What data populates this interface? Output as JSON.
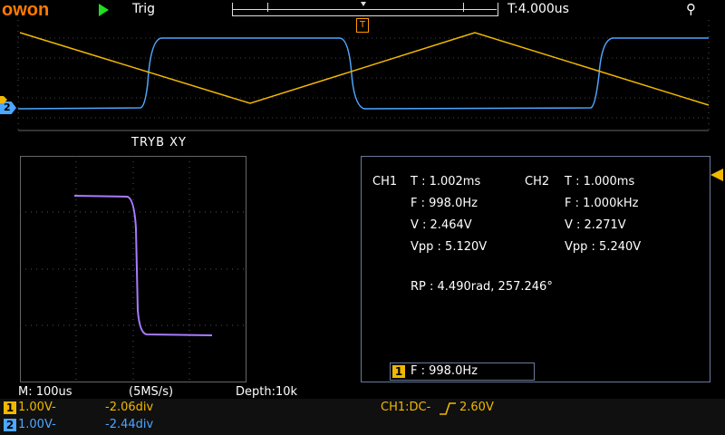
{
  "header": {
    "brand": "owon",
    "trigger_status": "Trig",
    "time_offset": "T:4.000us",
    "trigger_marker": "T"
  },
  "xy_title": "TRYB XY",
  "measurements": {
    "ch1": {
      "label": "CH1",
      "T": "T : 1.002ms",
      "F": "F : 998.0Hz",
      "V": "V : 2.464V",
      "Vpp": "Vpp : 5.120V"
    },
    "ch2": {
      "label": "CH2",
      "T": "T : 1.000ms",
      "F": "F : 1.000kHz",
      "V": "V : 2.271V",
      "Vpp": "Vpp : 5.240V"
    },
    "rp": "RP : 4.490rad, 257.246°"
  },
  "freq_counter": {
    "channel": "1",
    "text": "F : 998.0Hz"
  },
  "status_bar": {
    "timebase": "M: 100us",
    "sample_rate": "(5MS/s)",
    "depth": "Depth:10k"
  },
  "channels": [
    {
      "num": "1",
      "volts": "1.00V-",
      "offset": "-2.06div",
      "color": "#f0b800"
    },
    {
      "num": "2",
      "volts": "1.00V-",
      "offset": "-2.44div",
      "color": "#4da6ff"
    }
  ],
  "trigger_info": "CH1:DC-",
  "trigger_level": "2.60V",
  "ch2_marker": "2",
  "colors": {
    "ch1": "#f0b800",
    "ch2": "#4da6ff",
    "xy_trace": "#a77bff",
    "brand": "#ff7a00",
    "run": "#22dd22"
  }
}
